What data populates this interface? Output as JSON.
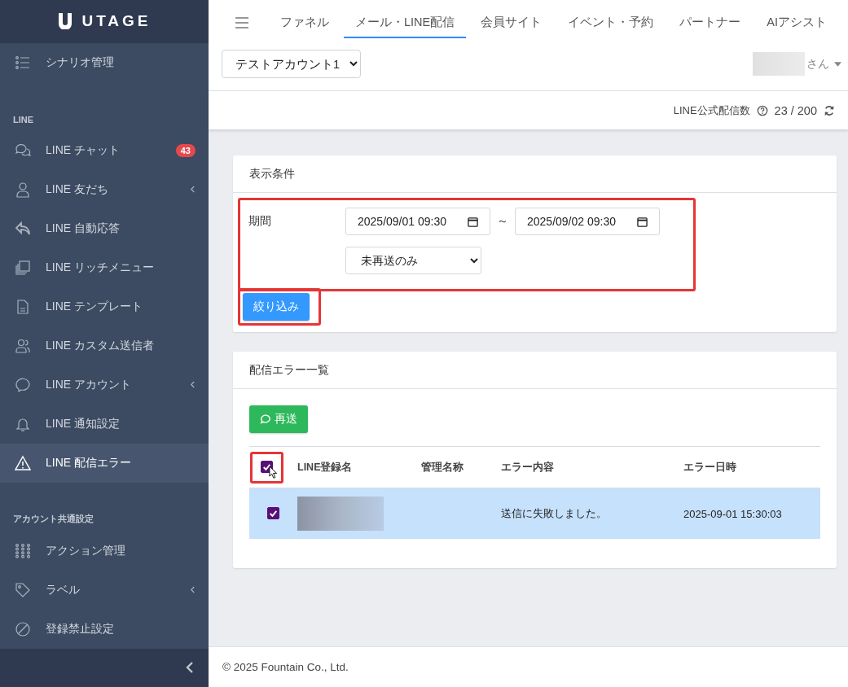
{
  "brand": {
    "name": "UTAGE"
  },
  "sidebar": {
    "sections": [
      {
        "items": [
          {
            "label": "シナリオ管理",
            "kind": "list",
            "submenu": false,
            "selected": false
          }
        ]
      },
      {
        "heading": "LINE",
        "items": [
          {
            "label": "LINE チャット",
            "kind": "chat",
            "badge": "43",
            "submenu": false,
            "selected": false
          },
          {
            "label": "LINE 友だち",
            "kind": "user",
            "submenu": true,
            "selected": false
          },
          {
            "label": "LINE 自動応答",
            "kind": "reply",
            "submenu": false,
            "selected": false
          },
          {
            "label": "LINE リッチメニュー",
            "kind": "copy",
            "submenu": false,
            "selected": false
          },
          {
            "label": "LINE テンプレート",
            "kind": "file",
            "submenu": false,
            "selected": false
          },
          {
            "label": "LINE カスタム送信者",
            "kind": "users",
            "submenu": false,
            "selected": false
          },
          {
            "label": "LINE アカウント",
            "kind": "comment",
            "submenu": true,
            "selected": false
          },
          {
            "label": "LINE 通知設定",
            "kind": "bell",
            "submenu": false,
            "selected": false
          },
          {
            "label": "LINE 配信エラー",
            "kind": "warning",
            "submenu": false,
            "selected": true
          }
        ]
      },
      {
        "heading": "アカウント共通設定",
        "items": [
          {
            "label": "アクション管理",
            "kind": "grid",
            "submenu": false,
            "selected": false
          },
          {
            "label": "ラベル",
            "kind": "tag",
            "submenu": true,
            "selected": false
          },
          {
            "label": "登録禁止設定",
            "kind": "ban",
            "submenu": false,
            "selected": false
          }
        ]
      }
    ]
  },
  "top_nav": {
    "tabs": [
      {
        "label": "ファネル",
        "selected": false
      },
      {
        "label": "メール・LINE配信",
        "selected": true
      },
      {
        "label": "会員サイト",
        "selected": false
      },
      {
        "label": "イベント・予約",
        "selected": false
      },
      {
        "label": "パートナー",
        "selected": false
      },
      {
        "label": "AIアシスト",
        "selected": false
      }
    ]
  },
  "account_select": {
    "value": "テストアカウント1"
  },
  "user": {
    "suffix": "さん"
  },
  "quota": {
    "label": "LINE公式配信数",
    "value": "23 / 200"
  },
  "filter_card": {
    "title": "表示条件",
    "period_label": "期間",
    "date_from": "2025/09/01 09:30",
    "separator": "～",
    "date_to": "2025/09/02 09:30",
    "status_select": "未再送のみ",
    "highlighted": true,
    "button": {
      "label": "絞り込み",
      "highlighted": true
    }
  },
  "error_card": {
    "title": "配信エラー一覧",
    "resend_button": "再送",
    "table": {
      "select_all": {
        "checked": true,
        "highlighted": true
      },
      "columns": [
        "LINE登録名",
        "管理名称",
        "エラー内容",
        "エラー日時"
      ],
      "rows": [
        {
          "checked": true,
          "selected": true,
          "name_redacted": true,
          "error": "送信に失敗しました。",
          "date": "2025-09-01 15:30:03"
        }
      ]
    }
  },
  "footer": "© 2025 Fountain Co., Ltd."
}
